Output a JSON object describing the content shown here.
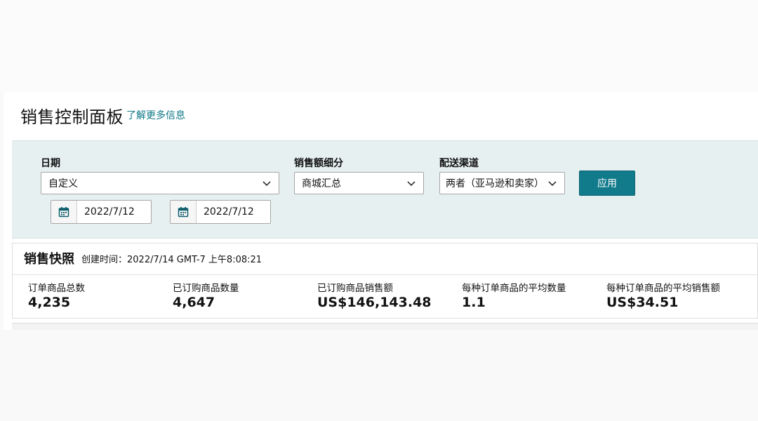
{
  "header": {
    "title": "销售控制面板",
    "learn_more": "了解更多信息"
  },
  "filters": {
    "date": {
      "label": "日期",
      "selected": "自定义",
      "start_date": "2022/7/12",
      "end_date": "2022/7/12"
    },
    "sales_breakdown": {
      "label": "销售额细分",
      "selected": "商城汇总"
    },
    "fulfillment": {
      "label": "配送渠道",
      "selected": "两者（亚马逊和卖家）"
    },
    "apply_label": "应用"
  },
  "snapshot": {
    "title": "销售快照",
    "created": "创建时间：2022/7/14 GMT-7 上午8:08:21",
    "metrics": [
      {
        "label": "订单商品总数",
        "value": "4,235"
      },
      {
        "label": "已订购商品数量",
        "value": "4,647"
      },
      {
        "label": "已订购商品销售额",
        "value": "US$146,143.48"
      },
      {
        "label": "每种订单商品的平均数量",
        "value": "1.1"
      },
      {
        "label": "每种订单商品的平均销售额",
        "value": "US$34.51"
      }
    ]
  },
  "icons": {
    "calendar": "calendar-icon",
    "dropdown": "chevron-down-icon"
  },
  "colors": {
    "accent": "#117a8b",
    "link": "#0e7886",
    "filter_bg": "#e6f0f0"
  }
}
